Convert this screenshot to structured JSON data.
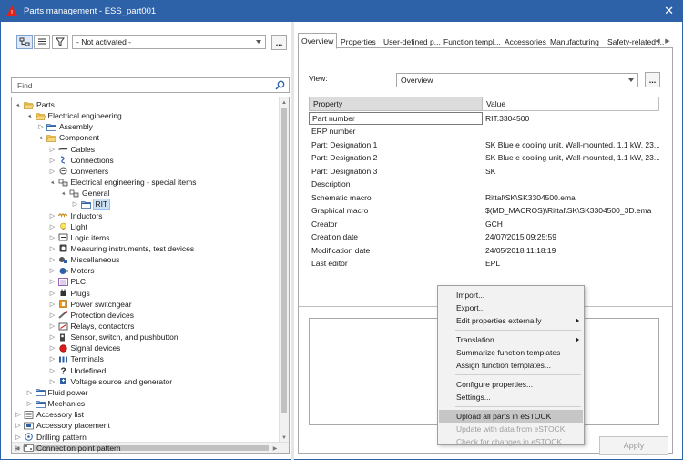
{
  "window": {
    "title": "Parts management - ESS_part001",
    "close_glyph": "✕"
  },
  "left": {
    "filter_value": "- Not activated -",
    "more_label": "...",
    "find_placeholder": "Find",
    "tree": [
      {
        "label": "Parts",
        "level": 0,
        "expander": "▲",
        "icon": "folder-open"
      },
      {
        "label": "Electrical engineering",
        "level": 1,
        "expander": "▲",
        "icon": "folder-open"
      },
      {
        "label": "Assembly",
        "level": 2,
        "expander": "▷",
        "icon": "folder"
      },
      {
        "label": "Component",
        "level": 2,
        "expander": "▲",
        "icon": "folder-open"
      },
      {
        "label": "Cables",
        "level": 3,
        "expander": "▷",
        "icon": "cable"
      },
      {
        "label": "Connections",
        "level": 3,
        "expander": "▷",
        "icon": "connection"
      },
      {
        "label": "Converters",
        "level": 3,
        "expander": "▷",
        "icon": "converter"
      },
      {
        "label": "Electrical engineering - special items",
        "level": 3,
        "expander": "▲",
        "icon": "special"
      },
      {
        "label": "General",
        "level": 4,
        "expander": "▲",
        "icon": "special"
      },
      {
        "label": "RIT",
        "level": 5,
        "expander": "▷",
        "icon": "folder",
        "selected": true
      },
      {
        "label": "Inductors",
        "level": 3,
        "expander": "▷",
        "icon": "inductor"
      },
      {
        "label": "Light",
        "level": 3,
        "expander": "▷",
        "icon": "light"
      },
      {
        "label": "Logic items",
        "level": 3,
        "expander": "▷",
        "icon": "logic"
      },
      {
        "label": "Measuring instruments, test devices",
        "level": 3,
        "expander": "▷",
        "icon": "measure"
      },
      {
        "label": "Miscellaneous",
        "level": 3,
        "expander": "▷",
        "icon": "misc"
      },
      {
        "label": "Motors",
        "level": 3,
        "expander": "▷",
        "icon": "motor"
      },
      {
        "label": "PLC",
        "level": 3,
        "expander": "▷",
        "icon": "plc"
      },
      {
        "label": "Plugs",
        "level": 3,
        "expander": "▷",
        "icon": "plug"
      },
      {
        "label": "Power switchgear",
        "level": 3,
        "expander": "▷",
        "icon": "switchgear"
      },
      {
        "label": "Protection devices",
        "level": 3,
        "expander": "▷",
        "icon": "protection"
      },
      {
        "label": "Relays, contactors",
        "level": 3,
        "expander": "▷",
        "icon": "relay"
      },
      {
        "label": "Sensor, switch, and pushbutton",
        "level": 3,
        "expander": "▷",
        "icon": "sensor"
      },
      {
        "label": "Signal devices",
        "level": 3,
        "expander": "▷",
        "icon": "signal"
      },
      {
        "label": "Terminals",
        "level": 3,
        "expander": "▷",
        "icon": "terminal"
      },
      {
        "label": "Undefined",
        "level": 3,
        "expander": "▷",
        "icon": "undefined"
      },
      {
        "label": "Voltage source and generator",
        "level": 3,
        "expander": "▷",
        "icon": "voltage"
      },
      {
        "label": "Fluid power",
        "level": 1,
        "expander": "▷",
        "icon": "folder"
      },
      {
        "label": "Mechanics",
        "level": 1,
        "expander": "▷",
        "icon": "folder"
      },
      {
        "label": "Accessory list",
        "level": 0,
        "expander": "▷",
        "icon": "list"
      },
      {
        "label": "Accessory placement",
        "level": 0,
        "expander": "▷",
        "icon": "placement"
      },
      {
        "label": "Drilling pattern",
        "level": 0,
        "expander": "▷",
        "icon": "drill"
      },
      {
        "label": "Connection point pattern",
        "level": 0,
        "expander": "▷",
        "icon": "pattern"
      }
    ]
  },
  "right": {
    "tabs": [
      {
        "label": "Overview",
        "active": true
      },
      {
        "label": "Properties"
      },
      {
        "label": "User-defined p..."
      },
      {
        "label": "Function templ..."
      },
      {
        "label": "Accessories"
      },
      {
        "label": "Manufacturing"
      },
      {
        "label": "Safety-related ..."
      }
    ],
    "view_label": "View:",
    "view_value": "Overview",
    "more_label": "...",
    "grid": {
      "headers": {
        "property": "Property",
        "value": "Value"
      },
      "rows": [
        {
          "property": "Part number",
          "value": "RIT.3304500"
        },
        {
          "property": "ERP number",
          "value": ""
        },
        {
          "property": "Part: Designation 1",
          "value": "SK Blue e cooling unit, Wall-mounted, 1.1 kW, 23..."
        },
        {
          "property": "Part: Designation 2",
          "value": "SK Blue e cooling unit, Wall-mounted, 1.1 kW, 23..."
        },
        {
          "property": "Part: Designation 3",
          "value": "SK"
        },
        {
          "property": "Description",
          "value": ""
        },
        {
          "property": "Schematic macro",
          "value": "Rittal\\SK\\SK3304500.ema"
        },
        {
          "property": "Graphical macro",
          "value": "$(MD_MACROS)\\Rittal\\SK\\SK3304500_3D.ema"
        },
        {
          "property": "Creator",
          "value": "GCH"
        },
        {
          "property": "Creation date",
          "value": "24/07/2015 09:25:59"
        },
        {
          "property": "Modification date",
          "value": "24/05/2018 11:18:19"
        },
        {
          "property": "Last editor",
          "value": "EPL"
        }
      ]
    },
    "apply_label": "Apply"
  },
  "context_menu": {
    "items": [
      {
        "label": "Import..."
      },
      {
        "label": "Export..."
      },
      {
        "label": "Edit properties externally",
        "submenu": true
      },
      {
        "separator": true
      },
      {
        "label": "Translation",
        "submenu": true
      },
      {
        "label": "Summarize function templates"
      },
      {
        "label": "Assign function templates..."
      },
      {
        "separator": true
      },
      {
        "label": "Configure properties..."
      },
      {
        "label": "Settings..."
      },
      {
        "separator": true
      },
      {
        "label": "Upload all parts in eSTOCK",
        "highlighted": true
      },
      {
        "label": "Update with data from eSTOCK",
        "disabled": true
      },
      {
        "label": "Check for changes in eSTOCK",
        "disabled": true
      }
    ]
  },
  "colors": {
    "titlebar": "#2d61a8",
    "selection": "#cce0f5",
    "menu_highlight": "#c6c6c6",
    "folder": "#f0c14b",
    "logo_red": "#e2231a"
  }
}
